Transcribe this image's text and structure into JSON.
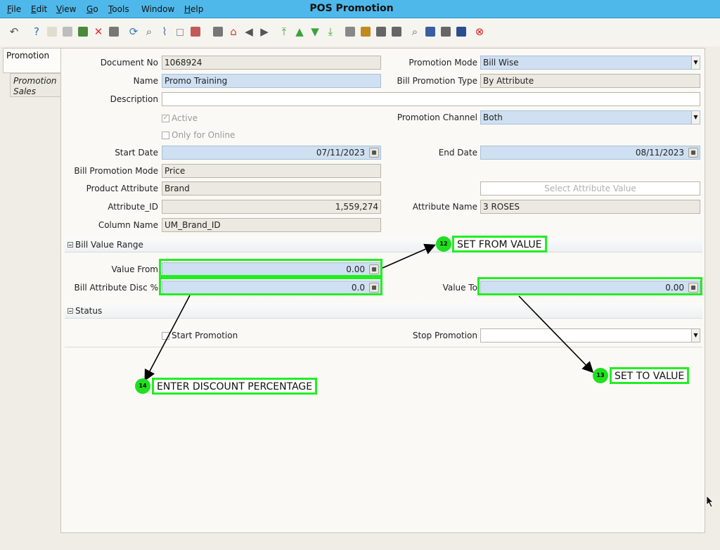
{
  "window": {
    "title": "POS Promotion"
  },
  "menu": [
    {
      "label": "File",
      "mn": "F",
      "rest": "ile"
    },
    {
      "label": "Edit",
      "mn": "E",
      "rest": "dit"
    },
    {
      "label": "View",
      "mn": "V",
      "rest": "iew"
    },
    {
      "label": "Go",
      "mn": "G",
      "rest": "o"
    },
    {
      "label": "Tools",
      "mn": "T",
      "rest": "ools"
    },
    {
      "label": "Window",
      "mn": "",
      "rest": "Window"
    },
    {
      "label": "Help",
      "mn": "H",
      "rest": "elp"
    }
  ],
  "toolbar_icons": [
    {
      "name": "undo-icon",
      "color": "#555555"
    },
    {
      "name": "help-icon",
      "color": "#2a6fb8"
    },
    {
      "name": "new-record-icon",
      "color": "#e0ddd0"
    },
    {
      "name": "copy-record-icon",
      "color": "#bdbdbd"
    },
    {
      "name": "save-icon",
      "color": "#4a8a3a"
    },
    {
      "name": "delete-icon",
      "color": "#e03030"
    },
    {
      "name": "save-disk-icon",
      "color": "#777777"
    },
    {
      "name": "refresh-icon",
      "color": "#3a76b8"
    },
    {
      "name": "find-icon",
      "color": "#555555"
    },
    {
      "name": "attachment-icon",
      "color": "#4a6fa0"
    },
    {
      "name": "chat-icon",
      "color": "#8a8a8a"
    },
    {
      "name": "grid-toggle-icon",
      "color": "#c25a5a"
    },
    {
      "name": "history-icon",
      "color": "#777777"
    },
    {
      "name": "home-icon",
      "color": "#d04030"
    },
    {
      "name": "back-icon",
      "color": "#555555"
    },
    {
      "name": "forward-icon",
      "color": "#555555"
    },
    {
      "name": "first-record-icon",
      "color": "#3aa23a"
    },
    {
      "name": "previous-record-icon",
      "color": "#3aa23a"
    },
    {
      "name": "next-record-icon",
      "color": "#3aa23a"
    },
    {
      "name": "last-record-icon",
      "color": "#3aa23a"
    },
    {
      "name": "report-icon",
      "color": "#888888"
    },
    {
      "name": "archive-icon",
      "color": "#c08a20"
    },
    {
      "name": "print-preview-icon",
      "color": "#666666"
    },
    {
      "name": "print-icon",
      "color": "#666666"
    },
    {
      "name": "zoom-across-icon",
      "color": "#555555"
    },
    {
      "name": "workflow-icon",
      "color": "#3a5fa0"
    },
    {
      "name": "product-info-icon",
      "color": "#666666"
    },
    {
      "name": "process-icon",
      "color": "#2a4f8f"
    },
    {
      "name": "close-window-icon",
      "color": "#d82020"
    }
  ],
  "tabs": {
    "promotion": "Promotion",
    "promotion_sales": "Promotion Sales"
  },
  "form": {
    "document_no": {
      "label": "Document No",
      "value": "1068924"
    },
    "name": {
      "label": "Name",
      "value": "Promo Training"
    },
    "description": {
      "label": "Description",
      "value": ""
    },
    "active": {
      "label": "Active",
      "checked": true
    },
    "only_online": {
      "label": "Only for Online",
      "checked": false
    },
    "start_date": {
      "label": "Start Date",
      "value": "07/11/2023"
    },
    "bill_promotion_mode": {
      "label": "Bill Promotion Mode",
      "value": "Price"
    },
    "product_attribute": {
      "label": "Product Attribute",
      "value": "Brand"
    },
    "attribute_id": {
      "label": "Attribute_ID",
      "value": "1,559,274"
    },
    "column_name": {
      "label": "Column Name",
      "value": "UM_Brand_ID"
    },
    "promotion_mode": {
      "label": "Promotion Mode",
      "value": "Bill Wise"
    },
    "bill_promotion_type": {
      "label": "Bill Promotion Type",
      "value": "By Attribute"
    },
    "promotion_channel": {
      "label": "Promotion Channel",
      "value": "Both"
    },
    "end_date": {
      "label": "End Date",
      "value": "08/11/2023"
    },
    "select_attribute_value": {
      "placeholder": "Select Attribute Value"
    },
    "attribute_name": {
      "label": "Attribute Name",
      "value": "3 ROSES"
    }
  },
  "sections": {
    "bill_value_range": "Bill Value Range",
    "status": "Status"
  },
  "bill_value_range": {
    "value_from": {
      "label": "Value From",
      "value": "0.00"
    },
    "bill_attribute_disc": {
      "label": "Bill Attribute Disc %",
      "value": "0.0"
    },
    "value_to": {
      "label": "Value To",
      "value": "0.00"
    }
  },
  "status": {
    "start_promotion": {
      "label": "Start Promotion",
      "checked": false
    },
    "stop_promotion": {
      "label": "Stop Promotion",
      "value": ""
    }
  },
  "annotations": {
    "set_from_value": {
      "number": "12",
      "text": "SET FROM VALUE"
    },
    "set_to_value": {
      "number": "13",
      "text": "SET TO VALUE"
    },
    "enter_discount": {
      "number": "14",
      "text": "ENTER DISCOUNT PERCENTAGE"
    }
  },
  "colors": {
    "menubar": "#4fb8ea",
    "highlight": "#22ee22",
    "field_blue": "#cfe0f2"
  }
}
